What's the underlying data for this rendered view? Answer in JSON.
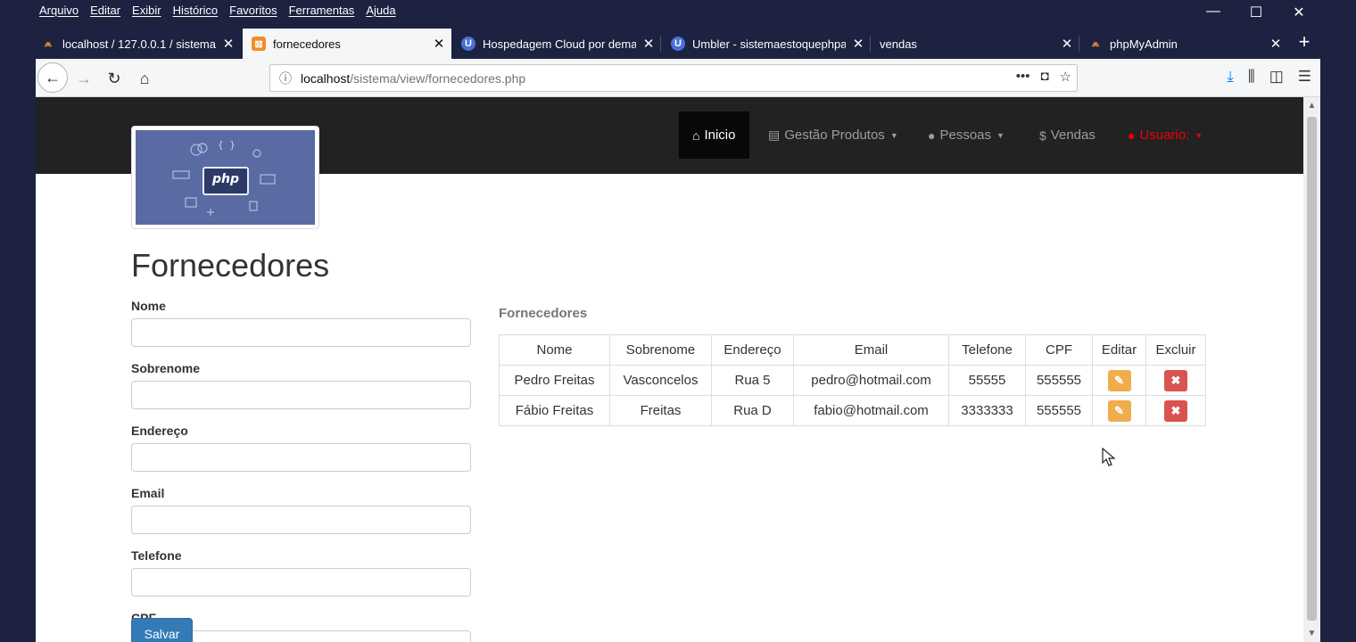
{
  "menubar": {
    "items": [
      "Arquivo",
      "Editar",
      "Exibir",
      "Histórico",
      "Favoritos",
      "Ferramentas",
      "Ajuda"
    ]
  },
  "window_controls": {
    "minimize": "—",
    "maximize": "☐",
    "close": "✕"
  },
  "tabs": [
    {
      "title": "localhost / 127.0.0.1 / sistema",
      "favicon": "phpmyadmin-icon",
      "active": false
    },
    {
      "title": "fornecedores",
      "favicon": "page-icon",
      "active": true
    },
    {
      "title": "Hospedagem Cloud por dema",
      "favicon": "umbler-icon",
      "active": false
    },
    {
      "title": "Umbler - sistemaestoquephpa",
      "favicon": "umbler-icon",
      "active": false
    },
    {
      "title": "vendas",
      "favicon": "",
      "active": false
    },
    {
      "title": "phpMyAdmin",
      "favicon": "phpmyadmin-icon",
      "active": false
    }
  ],
  "urlbar": {
    "host": "localhost",
    "path": "/sistema/view/fornecedores.php"
  },
  "site_nav": {
    "inicio": "Inicio",
    "gestao": "Gestão Produtos",
    "pessoas": "Pessoas",
    "vendas": "Vendas",
    "usuario": "Usuario:"
  },
  "logo": {
    "text": "php"
  },
  "page_title": "Fornecedores",
  "form": {
    "labels": {
      "nome": "Nome",
      "sobrenome": "Sobrenome",
      "endereco": "Endereço",
      "email": "Email",
      "telefone": "Telefone",
      "cpf": "CPF"
    },
    "submit": "Salvar"
  },
  "table": {
    "caption": "Fornecedores",
    "headers": [
      "Nome",
      "Sobrenome",
      "Endereço",
      "Email",
      "Telefone",
      "CPF",
      "Editar",
      "Excluir"
    ],
    "rows": [
      [
        "Pedro Freitas",
        "Vasconcelos",
        "Rua 5",
        "pedro@hotmail.com",
        "55555",
        "555555"
      ],
      [
        "Fábio Freitas",
        "Freitas",
        "Rua D",
        "fabio@hotmail.com",
        "3333333",
        "555555"
      ]
    ]
  },
  "colors": {
    "nav_bg": "#222222",
    "primary": "#337ab7",
    "warning": "#f0ad4e",
    "danger": "#d9534f",
    "chrome": "#1c2240"
  }
}
